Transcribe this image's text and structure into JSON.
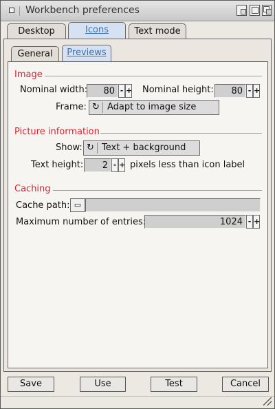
{
  "window": {
    "title": "Workbench preferences"
  },
  "tabs": [
    {
      "label": "Desktop"
    },
    {
      "label": "Icons"
    },
    {
      "label": "Text mode"
    }
  ],
  "subtabs": [
    {
      "label": "General"
    },
    {
      "label": "Previews"
    }
  ],
  "image": {
    "title": "Image",
    "nominal_width_label": "Nominal width:",
    "nominal_width": "80",
    "nominal_height_label": "Nominal height:",
    "nominal_height": "80",
    "frame_label": "Frame:",
    "frame_value": "Adapt to image size"
  },
  "picture": {
    "title": "Picture information",
    "show_label": "Show:",
    "show_value": "Text + background",
    "text_height_label": "Text height:",
    "text_height": "2",
    "text_height_suffix": "pixels less than icon label"
  },
  "caching": {
    "title": "Caching",
    "cache_path_label": "Cache path:",
    "cache_path": "",
    "max_entries_label": "Maximum number of entries:",
    "max_entries": "1024"
  },
  "buttons": {
    "save": "Save",
    "use": "Use",
    "test": "Test",
    "cancel": "Cancel"
  },
  "spin_minus": "-",
  "spin_plus": "+",
  "cycle_glyph": "↻",
  "file_glyph": "▭"
}
